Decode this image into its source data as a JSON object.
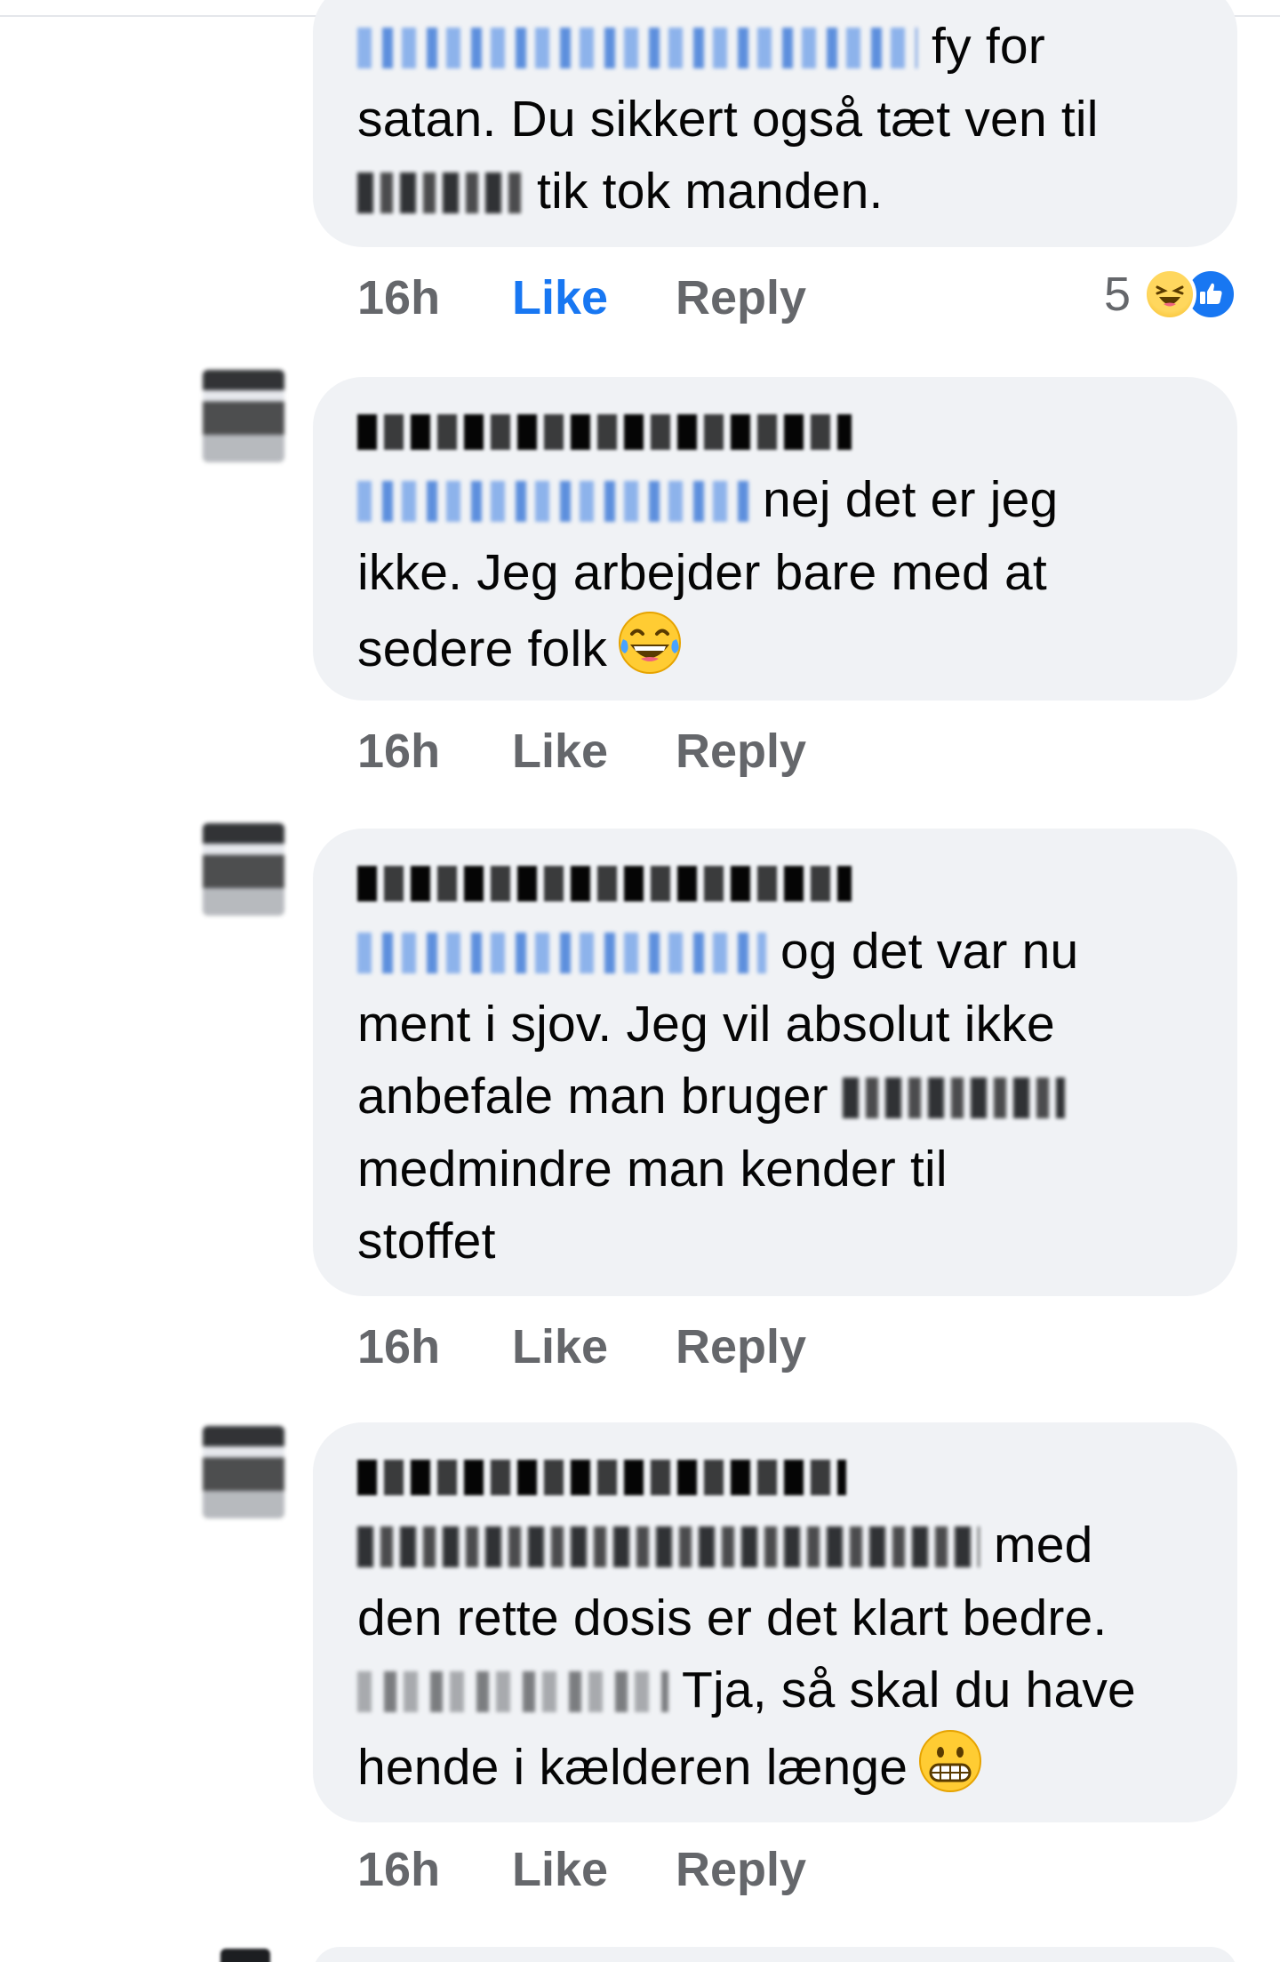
{
  "comments": [
    {
      "text_line1_after": "fy for",
      "text_line2": "satan. Du sikkert også tæt ven til",
      "text_line3_after": "tik tok manden.",
      "time": "16h",
      "like": "Like",
      "reply": "Reply",
      "reaction_count": "5",
      "reaction_icons": [
        "haha-icon",
        "like-icon"
      ]
    },
    {
      "text_line1_after": "nej det er jeg",
      "text_line2": "ikke. Jeg arbejder bare med at",
      "text_line3": "sedere folk",
      "emoji": "tears-of-joy-emoji",
      "time": "16h",
      "like": "Like",
      "reply": "Reply"
    },
    {
      "text_line1_after": "og det var nu",
      "text_line2": "ment i sjov. Jeg vil absolut ikke",
      "text_line3_before": "anbefale man bruger",
      "text_line4": "medmindre man kender til",
      "text_line5": "stoffet",
      "time": "16h",
      "like": "Like",
      "reply": "Reply"
    },
    {
      "text_line1_after": "med",
      "text_line2": "den rette dosis er det klart bedre.",
      "text_line3_after": "Tja, så skal du have",
      "text_line4": "hende i kælderen længe",
      "emoji": "grimacing-emoji",
      "time": "16h",
      "like": "Like",
      "reply": "Reply"
    }
  ],
  "colors": {
    "bubble": "#f0f2f5",
    "action_grey": "#65676b",
    "like_active": "#1877f2",
    "text": "#050505"
  }
}
